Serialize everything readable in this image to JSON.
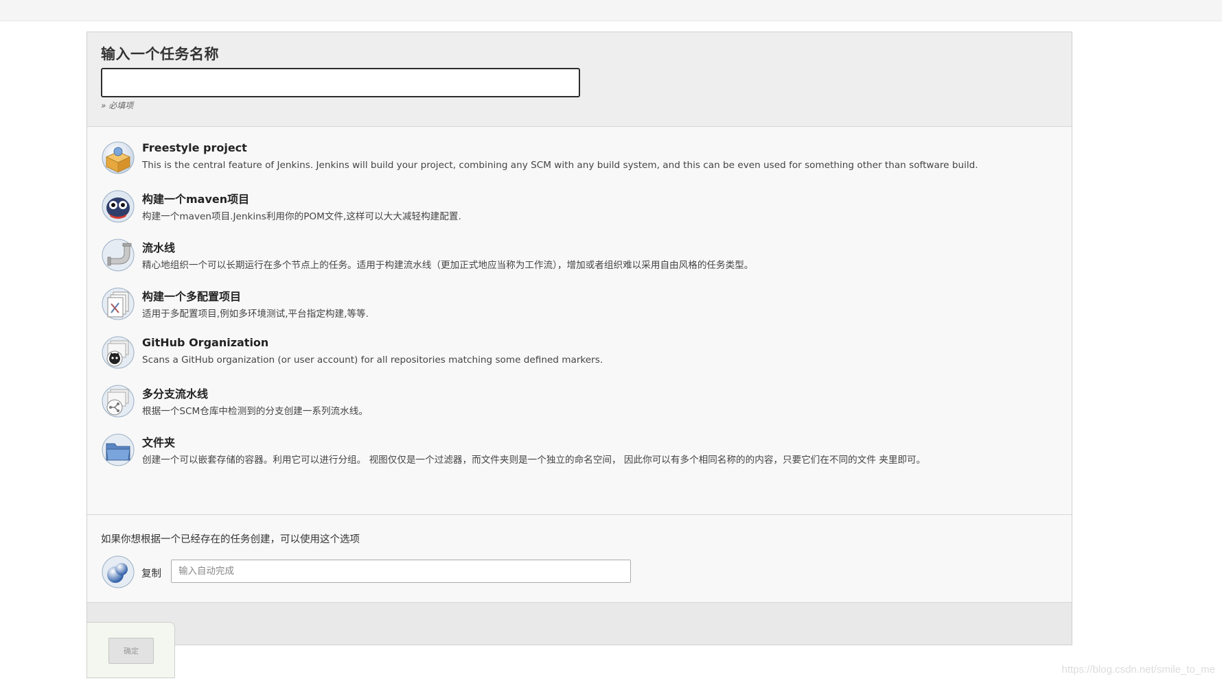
{
  "header": {
    "title": "输入一个任务名称",
    "name_value": "",
    "required_hint": "» 必填项"
  },
  "items": [
    {
      "name": "Freestyle project",
      "description": "This is the central feature of Jenkins. Jenkins will build your project, combining any SCM with any build system, and this can be even used for something other than software build.",
      "icon": "freestyle-box-icon"
    },
    {
      "name": "构建一个maven项目",
      "description": "构建一个maven项目.Jenkins利用你的POM文件,这样可以大大减轻构建配置.",
      "icon": "maven-owl-icon"
    },
    {
      "name": "流水线",
      "description": "精心地组织一个可以长期运行在多个节点上的任务。适用于构建流水线（更加正式地应当称为工作流），增加或者组织难以采用自由风格的任务类型。",
      "icon": "pipeline-icon"
    },
    {
      "name": "构建一个多配置项目",
      "description": "适用于多配置项目,例如多环境测试,平台指定构建,等等.",
      "icon": "multi-config-icon"
    },
    {
      "name": "GitHub Organization",
      "description": "Scans a GitHub organization (or user account) for all repositories matching some defined markers.",
      "icon": "github-organization-icon"
    },
    {
      "name": "多分支流水线",
      "description": "根据一个SCM仓库中检测到的分支创建一系列流水线。",
      "icon": "multibranch-pipeline-icon"
    },
    {
      "name": "文件夹",
      "description": "创建一个可以嵌套存储的容器。利用它可以进行分组。 视图仅仅是一个过滤器，而文件夹则是一个独立的命名空间， 因此你可以有多个相同名称的的内容，只要它们在不同的文件 夹里即可。",
      "icon": "folder-icon"
    }
  ],
  "copy": {
    "text": "如果你想根据一个已经存在的任务创建，可以使用这个选项",
    "label": "复制",
    "placeholder": "输入自动完成",
    "value": "",
    "icon": "copy-spheres-icon"
  },
  "footer": {
    "ok_label": "确定"
  },
  "watermark": "https://blog.csdn.net/smile_to_me"
}
